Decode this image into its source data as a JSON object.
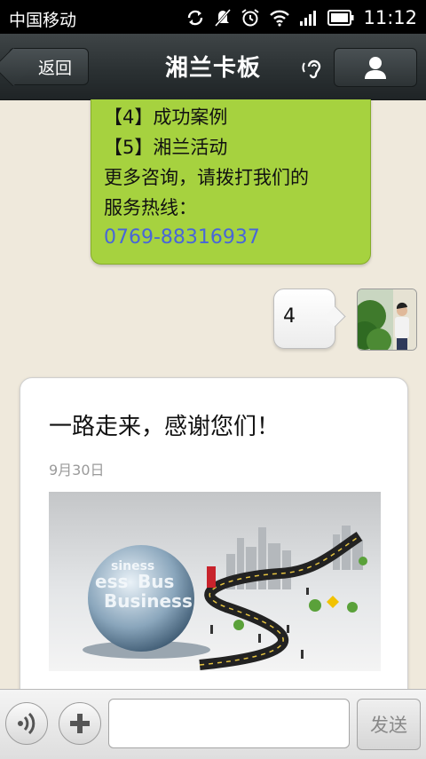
{
  "status_bar": {
    "carrier": "中国移动",
    "time": "11:12",
    "icons": [
      "sync-icon",
      "mute-icon",
      "alarm-icon",
      "wifi-icon",
      "signal-icon",
      "battery-icon"
    ]
  },
  "header": {
    "back_label": "返回",
    "title": "湘兰卡板",
    "icons": [
      "earpiece-icon",
      "profile-icon"
    ]
  },
  "messages": {
    "incoming_lines": [
      "【4】成功案例",
      "【5】湘兰活动",
      "更多咨询，请拨打我们的",
      "服务热线：",
      "0769-88316937"
    ],
    "outgoing_text": "4",
    "article": {
      "title": "一路走来，感谢您们！",
      "date": "9月30日",
      "image_words": [
        "siness",
        "ess",
        "Bus",
        "Business"
      ]
    }
  },
  "input_bar": {
    "value": "",
    "send_label": "发送",
    "icons": [
      "voice-icon",
      "plus-icon"
    ]
  },
  "colors": {
    "incoming_bubble": "#a6d23f",
    "phone_link": "#4866d8",
    "header_bg": "#2b3133",
    "chat_bg": "#efe9dc"
  }
}
